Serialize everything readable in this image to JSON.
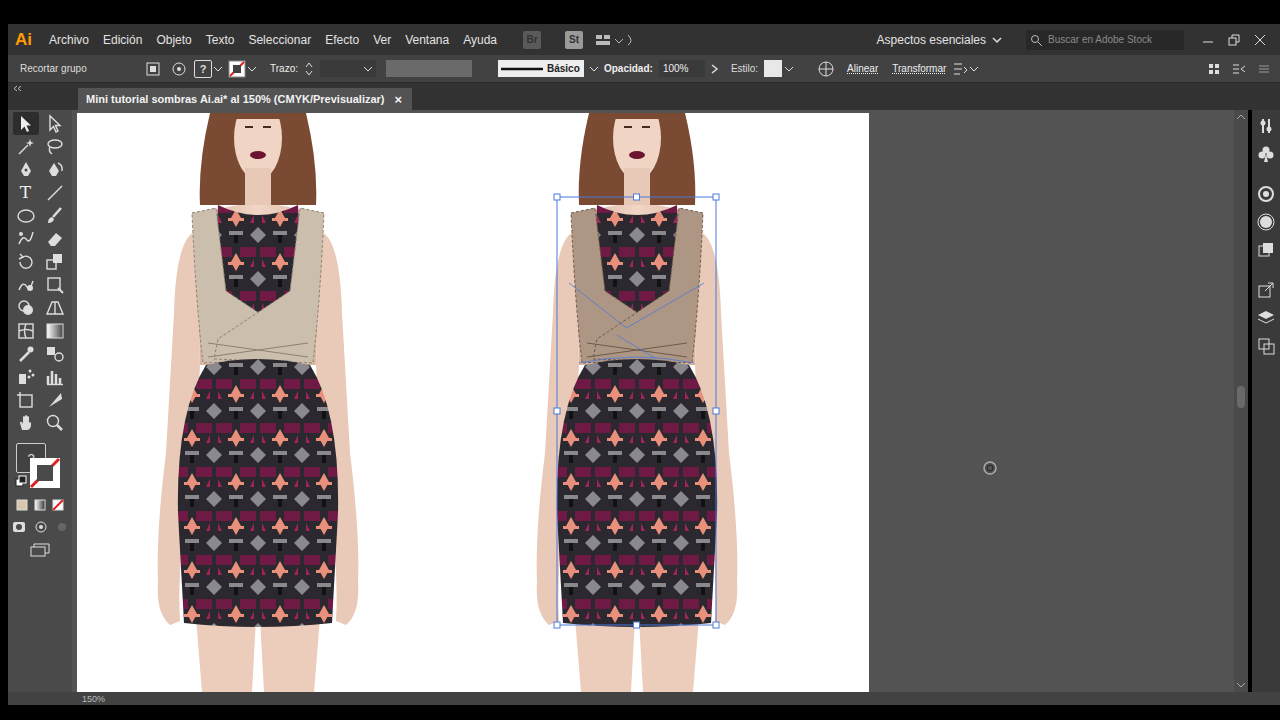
{
  "app": {
    "logo": "Ai",
    "menu": [
      "Archivo",
      "Edición",
      "Objeto",
      "Texto",
      "Seleccionar",
      "Efecto",
      "Ver",
      "Ventana",
      "Ayuda"
    ],
    "bridge": "Br",
    "stock": "St",
    "workspace": "Aspectos esenciales",
    "search": {
      "placeholder": "Buscar en Adobe Stock"
    }
  },
  "control_bar": {
    "selection": "Recortar grupo",
    "fill_unknown": "?",
    "stroke_label": "Trazo:",
    "stroke_profile": "Básico",
    "opacity_label": "Opacidad:",
    "opacity": "100%",
    "style_label": "Estilo:",
    "align": "Alinear",
    "transform": "Transformar"
  },
  "document_tab": {
    "title": "Mini tutorial sombras Ai.ai* al 150% (CMYK/Previsualizar)",
    "close": "×",
    "selected": true
  },
  "tools": {
    "type_glyph": "T",
    "fill_unknown": "?",
    "items": [
      {
        "selected": true
      },
      {
        "selected": false
      },
      {
        "selected": false
      },
      {
        "selected": false
      },
      {
        "selected": false
      },
      {
        "selected": false
      },
      {
        "selected": false
      },
      {
        "selected": false
      },
      {
        "selected": false
      },
      {
        "selected": false
      },
      {
        "selected": false
      },
      {
        "selected": false
      },
      {
        "selected": false
      },
      {
        "selected": false
      },
      {
        "selected": false
      },
      {
        "selected": false
      },
      {
        "selected": false
      },
      {
        "selected": false
      },
      {
        "selected": false
      },
      {
        "selected": false
      },
      {
        "selected": false
      },
      {
        "selected": false
      },
      {
        "selected": false
      },
      {
        "selected": false
      },
      {
        "selected": false
      },
      {
        "selected": false
      },
      {
        "selected": false
      },
      {
        "selected": false
      }
    ]
  },
  "canvas": {
    "figures": [
      {
        "selected": false
      },
      {
        "selected": true
      }
    ]
  },
  "status_bar": {
    "zoom": "150%"
  }
}
